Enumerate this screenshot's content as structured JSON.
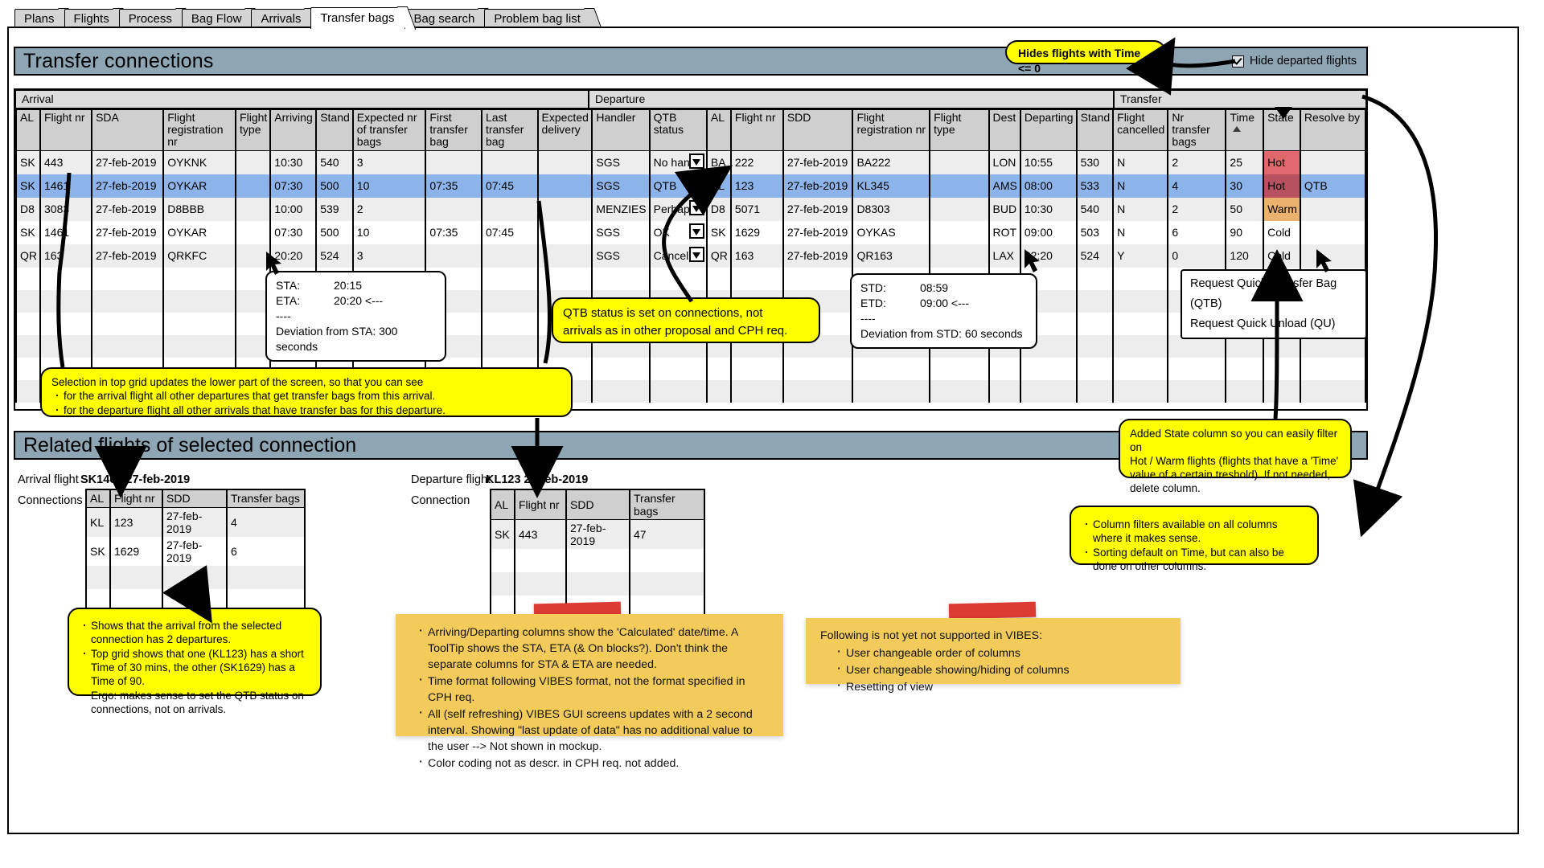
{
  "tabs": [
    {
      "label": "Plans",
      "active": false
    },
    {
      "label": "Flights",
      "active": false
    },
    {
      "label": "Process",
      "active": false
    },
    {
      "label": "Bag Flow",
      "active": false
    },
    {
      "label": "Arrivals",
      "active": false
    },
    {
      "label": "Transfer bags",
      "active": true
    },
    {
      "label": "Bag search",
      "active": false
    },
    {
      "label": "Problem bag list",
      "active": false
    }
  ],
  "header": {
    "title": "Transfer connections",
    "hide_departed_label": "Hide departed flights",
    "hide_departed_checked": true
  },
  "grid": {
    "bands": [
      {
        "label": "Arrival"
      },
      {
        "label": "Departure"
      },
      {
        "label": "Transfer"
      }
    ],
    "columns": [
      {
        "key": "a_al",
        "label": "AL",
        "group": "arrival"
      },
      {
        "key": "a_flight",
        "label": "Flight nr",
        "group": "arrival"
      },
      {
        "key": "a_sda",
        "label": "SDA",
        "group": "arrival"
      },
      {
        "key": "a_reg",
        "label": "Flight registration nr",
        "group": "arrival"
      },
      {
        "key": "a_type",
        "label": "Flight type",
        "group": "arrival"
      },
      {
        "key": "a_arriving",
        "label": "Arriving",
        "group": "arrival"
      },
      {
        "key": "a_stand",
        "label": "Stand",
        "group": "arrival"
      },
      {
        "key": "a_expbags",
        "label": "Expected nr of transfer bags",
        "group": "arrival"
      },
      {
        "key": "a_first",
        "label": "First transfer bag",
        "group": "arrival"
      },
      {
        "key": "a_last",
        "label": "Last transfer bag",
        "group": "arrival"
      },
      {
        "key": "a_expdel",
        "label": "Expected delivery",
        "group": "arrival"
      },
      {
        "key": "a_handler",
        "label": "Handler",
        "group": "arrival"
      },
      {
        "key": "a_qtb",
        "label": "QTB status",
        "group": "arrival"
      },
      {
        "key": "d_al",
        "label": "AL",
        "group": "departure"
      },
      {
        "key": "d_flight",
        "label": "Flight nr",
        "group": "departure"
      },
      {
        "key": "d_sdd",
        "label": "SDD",
        "group": "departure"
      },
      {
        "key": "d_reg",
        "label": "Flight registration nr",
        "group": "departure"
      },
      {
        "key": "d_type",
        "label": "Flight type",
        "group": "departure"
      },
      {
        "key": "d_dest",
        "label": "Dest",
        "group": "departure"
      },
      {
        "key": "d_departing",
        "label": "Departing",
        "group": "departure"
      },
      {
        "key": "d_stand",
        "label": "Stand",
        "group": "departure"
      },
      {
        "key": "d_cancelled",
        "label": "Flight cancelled",
        "group": "departure"
      },
      {
        "key": "t_nrbags",
        "label": "Nr transfer bags",
        "group": "transfer"
      },
      {
        "key": "t_time",
        "label": "Time",
        "group": "transfer",
        "sorted": "asc"
      },
      {
        "key": "t_state",
        "label": "State",
        "group": "transfer",
        "filtered": true
      },
      {
        "key": "t_resolve",
        "label": "Resolve by",
        "group": "transfer"
      }
    ],
    "rows": [
      {
        "selected": false,
        "a_al": "SK",
        "a_flight": "443",
        "a_sda": "27-feb-2019",
        "a_reg": "OYKNK",
        "a_type": "",
        "a_arriving": "10:30",
        "a_stand": "540",
        "a_expbags": "3",
        "a_first": "",
        "a_last": "",
        "a_expdel": "",
        "a_handler": "SGS",
        "a_qtb": "No hands",
        "d_al": "BA",
        "d_flight": "222",
        "d_sdd": "27-feb-2019",
        "d_reg": "BA222",
        "d_type": "",
        "d_dest": "LON",
        "d_departing": "10:55",
        "d_stand": "530",
        "d_cancelled": "N",
        "t_nrbags": "2",
        "t_time": "25",
        "t_state": "Hot",
        "t_state_style": "hot",
        "t_resolve": ""
      },
      {
        "selected": true,
        "a_al": "SK",
        "a_flight": "1461",
        "a_sda": "27-feb-2019",
        "a_reg": "OYKAR",
        "a_type": "",
        "a_arriving": "07:30",
        "a_stand": "500",
        "a_expbags": "10",
        "a_first": "07:35",
        "a_last": "07:45",
        "a_expdel": "",
        "a_handler": "SGS",
        "a_qtb": "QTB",
        "d_al": "KL",
        "d_flight": "123",
        "d_sdd": "27-feb-2019",
        "d_reg": "KL345",
        "d_type": "",
        "d_dest": "AMS",
        "d_departing": "08:00",
        "d_stand": "533",
        "d_cancelled": "N",
        "t_nrbags": "4",
        "t_time": "30",
        "t_state": "Hot",
        "t_state_style": "hot2",
        "t_resolve": "QTB"
      },
      {
        "selected": false,
        "a_al": "D8",
        "a_flight": "3083",
        "a_sda": "27-feb-2019",
        "a_reg": "D8BBB",
        "a_type": "",
        "a_arriving": "10:00",
        "a_stand": "539",
        "a_expbags": "2",
        "a_first": "",
        "a_last": "",
        "a_expdel": "",
        "a_handler": "MENZIES",
        "a_qtb": "Perhaps",
        "d_al": "D8",
        "d_flight": "5071",
        "d_sdd": "27-feb-2019",
        "d_reg": "D8303",
        "d_type": "",
        "d_dest": "BUD",
        "d_departing": "10:30",
        "d_stand": "540",
        "d_cancelled": "N",
        "t_nrbags": "2",
        "t_time": "50",
        "t_state": "Warm",
        "t_state_style": "warm",
        "t_resolve": ""
      },
      {
        "selected": false,
        "a_al": "SK",
        "a_flight": "1461",
        "a_sda": "27-feb-2019",
        "a_reg": "OYKAR",
        "a_type": "",
        "a_arriving": "07:30",
        "a_stand": "500",
        "a_expbags": "10",
        "a_first": "07:35",
        "a_last": "07:45",
        "a_expdel": "",
        "a_handler": "SGS",
        "a_qtb": "OK",
        "d_al": "SK",
        "d_flight": "1629",
        "d_sdd": "27-feb-2019",
        "d_reg": "OYKAS",
        "d_type": "",
        "d_dest": "ROT",
        "d_departing": "09:00",
        "d_stand": "503",
        "d_cancelled": "N",
        "t_nrbags": "6",
        "t_time": "90",
        "t_state": "Cold",
        "t_state_style": "none",
        "t_resolve": ""
      },
      {
        "selected": false,
        "a_al": "QR",
        "a_flight": "163",
        "a_sda": "27-feb-2019",
        "a_reg": "QRKFC",
        "a_type": "",
        "a_arriving": "20:20",
        "a_stand": "524",
        "a_expbags": "3",
        "a_first": "",
        "a_last": "",
        "a_expdel": "",
        "a_handler": "SGS",
        "a_qtb": "Cancelled",
        "d_al": "QR",
        "d_flight": "163",
        "d_sdd": "27-feb-2019",
        "d_reg": "QR163",
        "d_type": "",
        "d_dest": "LAX",
        "d_departing": "22:20",
        "d_stand": "524",
        "d_cancelled": "Y",
        "t_nrbags": "0",
        "t_time": "120",
        "t_state": "Cold",
        "t_state_style": "none",
        "t_resolve": ""
      }
    ]
  },
  "related": {
    "title": "Related flights of selected connection",
    "arrival": {
      "flight_label": "Arrival flight",
      "flight_value": "SK1461 27-feb-2019",
      "list_label": "Connections",
      "columns": [
        "AL",
        "Flight nr",
        "SDD",
        "Transfer bags"
      ],
      "rows": [
        [
          "KL",
          "123",
          "27-feb-2019",
          "4"
        ],
        [
          "SK",
          "1629",
          "27-feb-2019",
          "6"
        ]
      ]
    },
    "departure": {
      "flight_label": "Departure flight",
      "flight_value": "KL123 27-feb-2019",
      "list_label": "Connection",
      "columns": [
        "AL",
        "Flight nr",
        "SDD",
        "Transfer bags"
      ],
      "rows": [
        [
          "SK",
          "443",
          "27-feb-2019",
          "47"
        ]
      ]
    }
  },
  "tooltips": {
    "arrival": {
      "l1_key": "STA:",
      "l1_val": "20:15",
      "l2_key": "ETA:",
      "l2_val": "20:20 <---",
      "sep": "----",
      "l4": "Deviation from STA: 300 seconds"
    },
    "departure": {
      "l1_key": "STD:",
      "l1_val": "08:59",
      "l2_key": "ETD:",
      "l2_val": "09:00 <---",
      "sep": "----",
      "l4": "Deviation from STD: 60 seconds"
    }
  },
  "context_menu": {
    "items": [
      "Request Quick Transfer Bag (QTB)",
      "Request Quick Unload (QU)"
    ]
  },
  "notes": {
    "hide_pill": "Hides flights with Time <= 0",
    "selection": {
      "lead": "Selection in top grid updates the lower part of the screen, so that you can see",
      "bullets": [
        "for the arrival flight all other departures that get transfer bags from this arrival.",
        "for the departure flight all other arrivals that have transfer bas for this departure."
      ]
    },
    "qtb": {
      "line1": "QTB status is set on connections, not",
      "line2": "arrivals as in other proposal and CPH req."
    },
    "state_column": {
      "lines": [
        "Added State column so you can easily filter on",
        "Hot / Warm flights (flights that have a 'Time'",
        "value of a certain treshold). If not needed,",
        "delete column."
      ]
    },
    "filters": {
      "bullets": [
        "Column filters available on all columns where it makes sense.",
        "Sorting default on Time, but can also be done on other columns."
      ]
    },
    "arrival_explain": {
      "bullets": [
        "Shows that the arrival from the selected connection has 2 departures.",
        "Top grid shows that one (KL123) has a short Time of 30 mins, the other (SK1629) has a Time of 90.",
        "Ergo: makes sense to set the QTB status on connections, not on arrivals."
      ]
    },
    "orange_left": {
      "bullets": [
        "Arriving/Departing columns show the 'Calculated' date/time. A ToolTip shows the STA, ETA (& On blocks?). Don't think the separate columns for STA & ETA are needed.",
        "Time format following VIBES format, not the format specified in CPH req.",
        "All (self refreshing) VIBES GUI screens updates with a 2 second interval. Showing \"last update of data\"  has no additional value to the user --> Not shown in mockup.",
        "Color coding not as descr. in CPH req. not added."
      ]
    },
    "orange_right": {
      "lead": "Following is not yet not supported in VIBES:",
      "bullets": [
        "User changeable order of columns",
        "User changeable showing/hiding of columns",
        "Resetting of view"
      ]
    }
  },
  "colors": {
    "title_bar": "#8ea5b4",
    "selection": "#8cb4ea",
    "hot": "#e0686c",
    "hot_dark": "#b8515f",
    "warm": "#eab26c",
    "note": "#ffff00",
    "orange_note": "#f3cb5a",
    "tape": "#dc3b33"
  }
}
